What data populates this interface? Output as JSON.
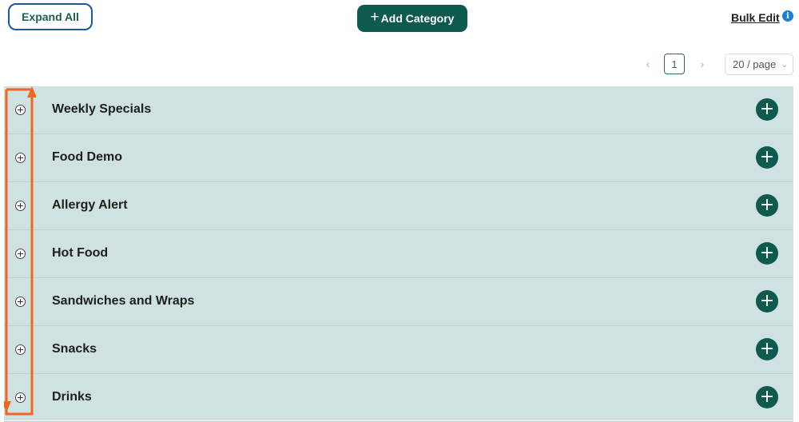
{
  "toolbar": {
    "expand_all_label": "Expand All",
    "add_category_label": "Add Category",
    "add_category_icon": "+",
    "bulk_edit_label": "Bulk Edit",
    "info_icon": "i"
  },
  "pagination": {
    "prev": "‹",
    "current_page": "1",
    "next": "›",
    "page_size": "20 / page",
    "page_size_chevron": "⌄"
  },
  "categories": [
    {
      "label": "Weekly Specials"
    },
    {
      "label": "Food Demo"
    },
    {
      "label": "Allergy Alert"
    },
    {
      "label": "Hot Food"
    },
    {
      "label": "Sandwiches and Wraps"
    },
    {
      "label": "Snacks"
    },
    {
      "label": "Drinks"
    }
  ],
  "row_toggle_icon": "+",
  "row_add_icon": "+",
  "colors": {
    "accent": "#0e5a4e",
    "row_background": "#cfe1e0",
    "annotation": "#f26522",
    "info": "#1f7fd6"
  }
}
